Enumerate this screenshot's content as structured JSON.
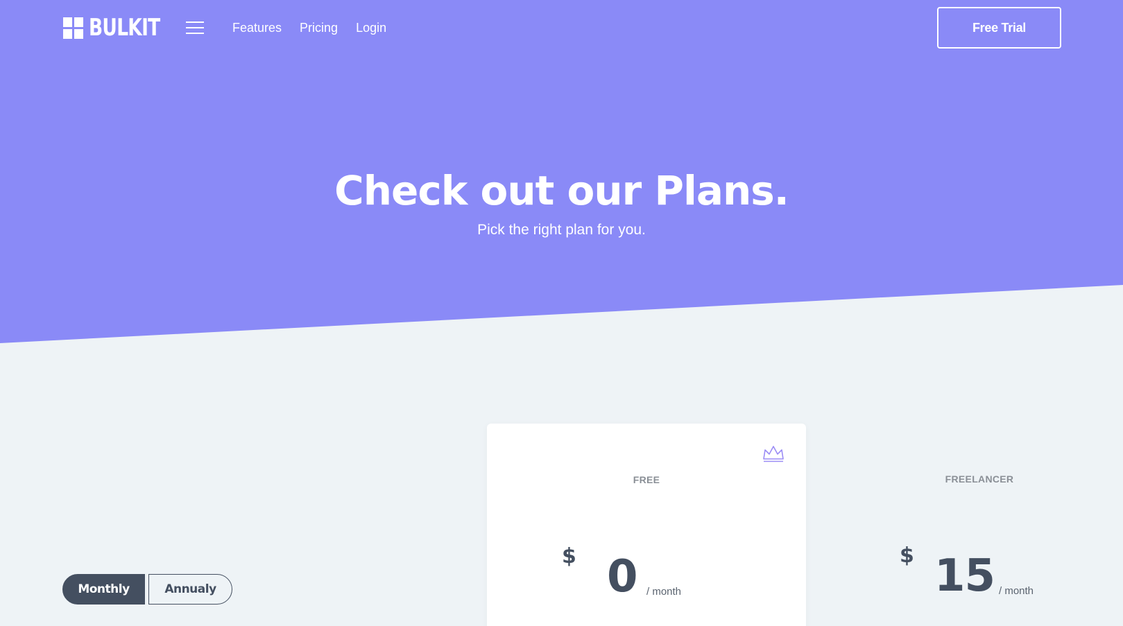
{
  "brand": {
    "name": "BULKIT"
  },
  "nav": {
    "links": [
      "Features",
      "Pricing",
      "Login"
    ],
    "cta_label": "Free Trial"
  },
  "hero": {
    "title": "Check out our Plans.",
    "subtitle": "Pick the right plan for you."
  },
  "billing_toggle": {
    "options": [
      "Monthly",
      "Annualy"
    ],
    "selected": "Monthly"
  },
  "plans": [
    {
      "name": "FREE",
      "currency": "$",
      "amount": "0",
      "period": "/ month",
      "featured_icon": "crown-icon"
    },
    {
      "name": "FREELANCER",
      "currency": "$",
      "amount": "15",
      "period": "/ month"
    }
  ],
  "colors": {
    "hero_background": "#8a8af7",
    "page_background": "#eef3f6",
    "dark_text": "#444f60",
    "accent_icon": "#9b8cf5"
  }
}
